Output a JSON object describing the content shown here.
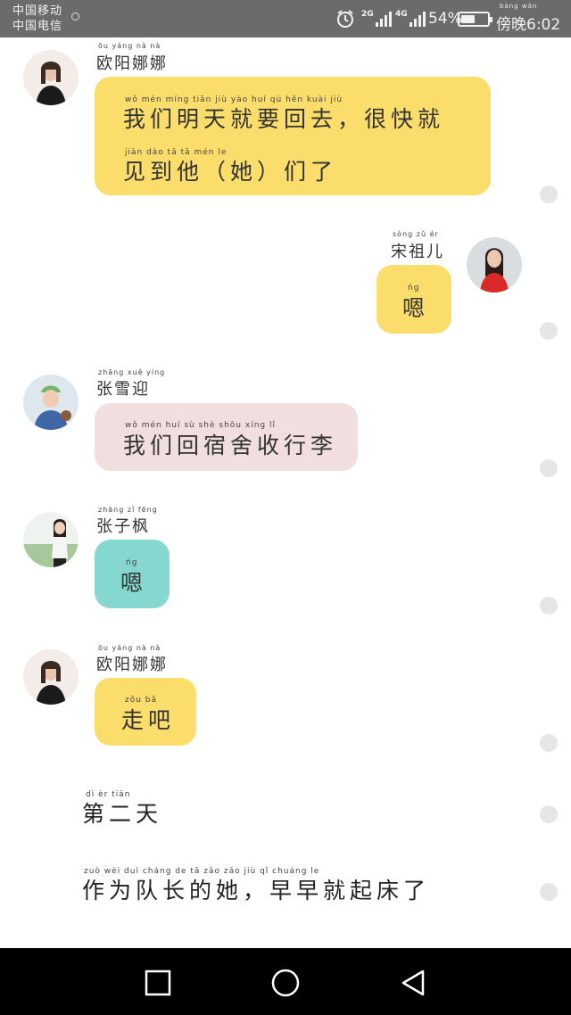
{
  "status_bar": {
    "carrier_1": "中国移动",
    "carrier_2": "中国电信",
    "net_1": "2G",
    "net_2": "4G",
    "battery": "54%",
    "battery_level": 0.54,
    "time": "傍晚6:02",
    "time_pinyin": "bàng wǎn"
  },
  "messages": [
    {
      "sender": "欧阳娜娜",
      "sender_pinyin": "ōu yáng nà nà",
      "side": "left",
      "color": "#fbdd6c",
      "lines": [
        {
          "pinyin": "wǒ  mén míng tiān  jiù  yào  huí  qù         hěn kuài  jiù",
          "text": "我们明天就要回去，很快就"
        },
        {
          "pinyin": "jiàn dào  tā          tā          mén  le",
          "text": "见到他（她）们了"
        }
      ]
    },
    {
      "sender": "宋祖儿",
      "sender_pinyin": "sòng  zǔ  ér",
      "side": "right",
      "color": "#fbdd6c",
      "lines": [
        {
          "pinyin": "ńg",
          "text": "嗯"
        }
      ]
    },
    {
      "sender": "张雪迎",
      "sender_pinyin": "zhāng xuě yíng",
      "side": "left",
      "color": "#f1dfdf",
      "lines": [
        {
          "pinyin": "wǒ  mén  huí  sù  shè shōu xíng  lǐ",
          "text": "我们回宿舍收行李"
        }
      ]
    },
    {
      "sender": "张子枫",
      "sender_pinyin": "zhāng  zǐ  fēng",
      "side": "left",
      "color": "#84d8cf",
      "lines": [
        {
          "pinyin": "ńg",
          "text": "嗯"
        }
      ]
    },
    {
      "sender": "欧阳娜娜",
      "sender_pinyin": "ōu yáng nà nà",
      "side": "left",
      "color": "#fbdd6c",
      "lines": [
        {
          "pinyin": "zǒu  bā",
          "text": "走吧"
        }
      ]
    }
  ],
  "narration": [
    {
      "pinyin": "dì   èr  tiān",
      "text": "第二天"
    },
    {
      "pinyin": "zuò  wèi  duì cháng  de    tā        zǎo  zǎo   jiù   qǐ  chuáng  le",
      "text": "作为队长的她，早早就起床了"
    }
  ],
  "nav": {
    "recent": "square-icon",
    "home": "circle-icon",
    "back": "triangle-back-icon"
  }
}
